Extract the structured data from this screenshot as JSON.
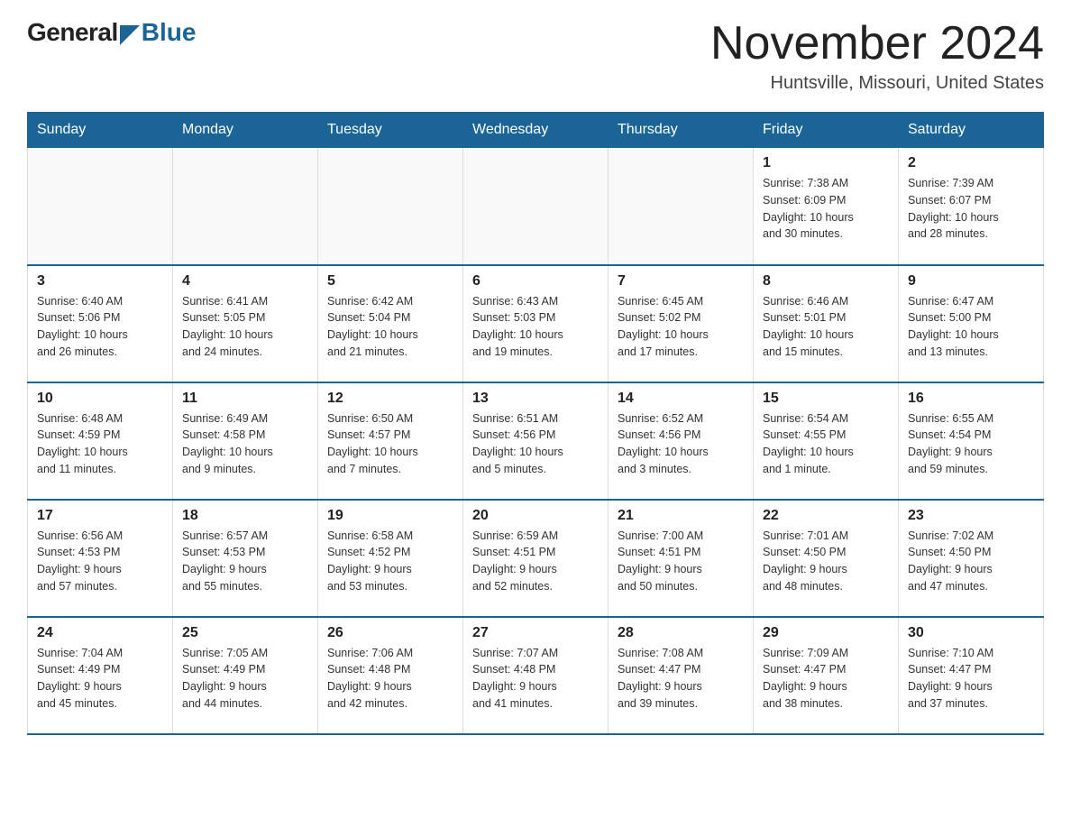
{
  "header": {
    "logo": {
      "general": "General",
      "blue": "Blue",
      "tagline": ""
    },
    "title": "November 2024",
    "subtitle": "Huntsville, Missouri, United States"
  },
  "weekdays": [
    "Sunday",
    "Monday",
    "Tuesday",
    "Wednesday",
    "Thursday",
    "Friday",
    "Saturday"
  ],
  "weeks": [
    [
      {
        "day": "",
        "info": ""
      },
      {
        "day": "",
        "info": ""
      },
      {
        "day": "",
        "info": ""
      },
      {
        "day": "",
        "info": ""
      },
      {
        "day": "",
        "info": ""
      },
      {
        "day": "1",
        "info": "Sunrise: 7:38 AM\nSunset: 6:09 PM\nDaylight: 10 hours\nand 30 minutes."
      },
      {
        "day": "2",
        "info": "Sunrise: 7:39 AM\nSunset: 6:07 PM\nDaylight: 10 hours\nand 28 minutes."
      }
    ],
    [
      {
        "day": "3",
        "info": "Sunrise: 6:40 AM\nSunset: 5:06 PM\nDaylight: 10 hours\nand 26 minutes."
      },
      {
        "day": "4",
        "info": "Sunrise: 6:41 AM\nSunset: 5:05 PM\nDaylight: 10 hours\nand 24 minutes."
      },
      {
        "day": "5",
        "info": "Sunrise: 6:42 AM\nSunset: 5:04 PM\nDaylight: 10 hours\nand 21 minutes."
      },
      {
        "day": "6",
        "info": "Sunrise: 6:43 AM\nSunset: 5:03 PM\nDaylight: 10 hours\nand 19 minutes."
      },
      {
        "day": "7",
        "info": "Sunrise: 6:45 AM\nSunset: 5:02 PM\nDaylight: 10 hours\nand 17 minutes."
      },
      {
        "day": "8",
        "info": "Sunrise: 6:46 AM\nSunset: 5:01 PM\nDaylight: 10 hours\nand 15 minutes."
      },
      {
        "day": "9",
        "info": "Sunrise: 6:47 AM\nSunset: 5:00 PM\nDaylight: 10 hours\nand 13 minutes."
      }
    ],
    [
      {
        "day": "10",
        "info": "Sunrise: 6:48 AM\nSunset: 4:59 PM\nDaylight: 10 hours\nand 11 minutes."
      },
      {
        "day": "11",
        "info": "Sunrise: 6:49 AM\nSunset: 4:58 PM\nDaylight: 10 hours\nand 9 minutes."
      },
      {
        "day": "12",
        "info": "Sunrise: 6:50 AM\nSunset: 4:57 PM\nDaylight: 10 hours\nand 7 minutes."
      },
      {
        "day": "13",
        "info": "Sunrise: 6:51 AM\nSunset: 4:56 PM\nDaylight: 10 hours\nand 5 minutes."
      },
      {
        "day": "14",
        "info": "Sunrise: 6:52 AM\nSunset: 4:56 PM\nDaylight: 10 hours\nand 3 minutes."
      },
      {
        "day": "15",
        "info": "Sunrise: 6:54 AM\nSunset: 4:55 PM\nDaylight: 10 hours\nand 1 minute."
      },
      {
        "day": "16",
        "info": "Sunrise: 6:55 AM\nSunset: 4:54 PM\nDaylight: 9 hours\nand 59 minutes."
      }
    ],
    [
      {
        "day": "17",
        "info": "Sunrise: 6:56 AM\nSunset: 4:53 PM\nDaylight: 9 hours\nand 57 minutes."
      },
      {
        "day": "18",
        "info": "Sunrise: 6:57 AM\nSunset: 4:53 PM\nDaylight: 9 hours\nand 55 minutes."
      },
      {
        "day": "19",
        "info": "Sunrise: 6:58 AM\nSunset: 4:52 PM\nDaylight: 9 hours\nand 53 minutes."
      },
      {
        "day": "20",
        "info": "Sunrise: 6:59 AM\nSunset: 4:51 PM\nDaylight: 9 hours\nand 52 minutes."
      },
      {
        "day": "21",
        "info": "Sunrise: 7:00 AM\nSunset: 4:51 PM\nDaylight: 9 hours\nand 50 minutes."
      },
      {
        "day": "22",
        "info": "Sunrise: 7:01 AM\nSunset: 4:50 PM\nDaylight: 9 hours\nand 48 minutes."
      },
      {
        "day": "23",
        "info": "Sunrise: 7:02 AM\nSunset: 4:50 PM\nDaylight: 9 hours\nand 47 minutes."
      }
    ],
    [
      {
        "day": "24",
        "info": "Sunrise: 7:04 AM\nSunset: 4:49 PM\nDaylight: 9 hours\nand 45 minutes."
      },
      {
        "day": "25",
        "info": "Sunrise: 7:05 AM\nSunset: 4:49 PM\nDaylight: 9 hours\nand 44 minutes."
      },
      {
        "day": "26",
        "info": "Sunrise: 7:06 AM\nSunset: 4:48 PM\nDaylight: 9 hours\nand 42 minutes."
      },
      {
        "day": "27",
        "info": "Sunrise: 7:07 AM\nSunset: 4:48 PM\nDaylight: 9 hours\nand 41 minutes."
      },
      {
        "day": "28",
        "info": "Sunrise: 7:08 AM\nSunset: 4:47 PM\nDaylight: 9 hours\nand 39 minutes."
      },
      {
        "day": "29",
        "info": "Sunrise: 7:09 AM\nSunset: 4:47 PM\nDaylight: 9 hours\nand 38 minutes."
      },
      {
        "day": "30",
        "info": "Sunrise: 7:10 AM\nSunset: 4:47 PM\nDaylight: 9 hours\nand 37 minutes."
      }
    ]
  ]
}
